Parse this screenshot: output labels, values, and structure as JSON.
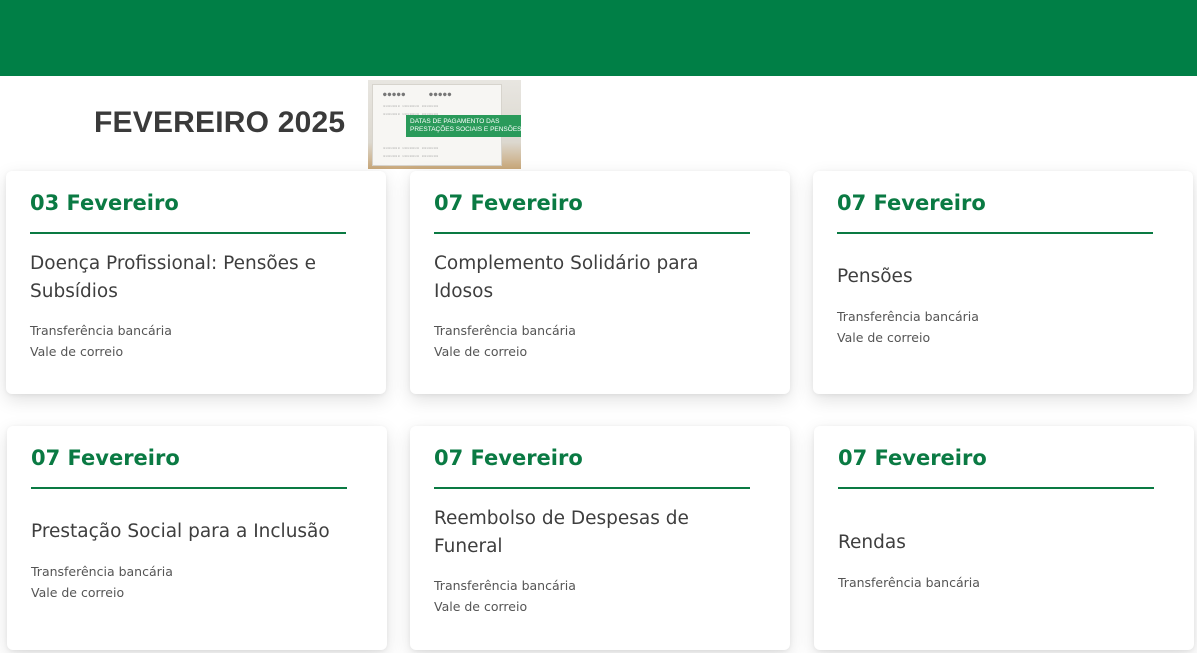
{
  "header": {
    "brand_color": "#007f46"
  },
  "banner": {
    "title": "FEVEREIRO 2025",
    "image_caption_line1": "DATAS DE PAGAMENTO DAS",
    "image_caption_line2": "PRESTAÇÕES SOCIAIS E PENSÕES"
  },
  "cards": [
    {
      "date": "03 Fevereiro",
      "title": "Doença Profissional: Pensões e Subsídios",
      "methods": [
        "Transferência bancária",
        "Vale de correio"
      ]
    },
    {
      "date": "07 Fevereiro",
      "title": "Complemento Solidário para Idosos",
      "methods": [
        "Transferência bancária",
        "Vale de correio"
      ]
    },
    {
      "date": "07 Fevereiro",
      "title": "Pensões",
      "methods": [
        "Transferência bancária",
        "Vale de correio"
      ]
    },
    {
      "date": "07 Fevereiro",
      "title": "Prestação Social para a Inclusão",
      "methods": [
        "Transferência bancária",
        "Vale de correio"
      ]
    },
    {
      "date": "07 Fevereiro",
      "title": "Reembolso de Despesas de Funeral",
      "methods": [
        "Transferência bancária",
        "Vale de correio"
      ]
    },
    {
      "date": "07 Fevereiro",
      "title": "Rendas",
      "methods": [
        "Transferência bancária"
      ]
    }
  ],
  "colors": {
    "accent_green": "#0a7a43",
    "text_dark": "#3e3e3e",
    "text_muted": "#555555"
  }
}
